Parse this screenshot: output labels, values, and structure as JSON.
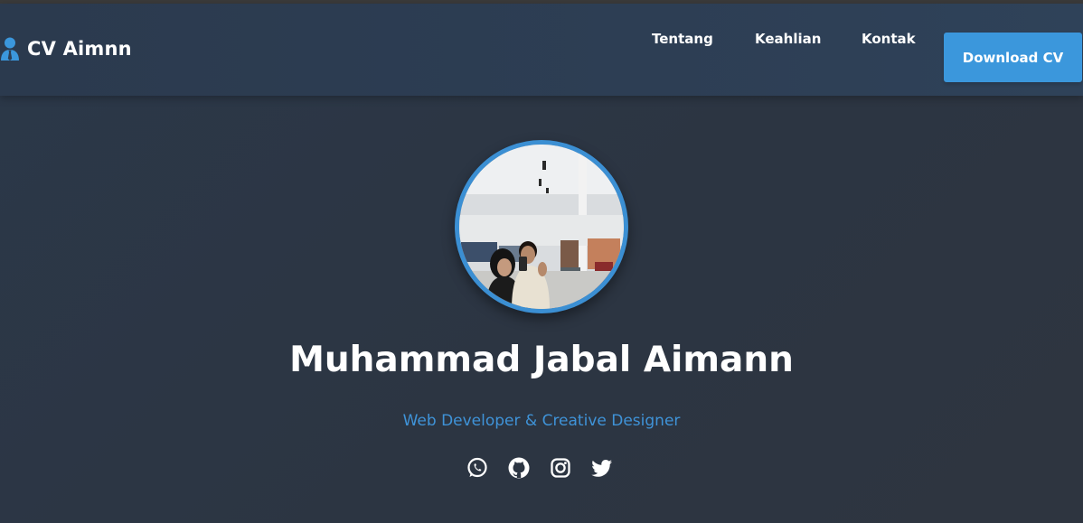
{
  "navbar": {
    "brand": "CV Aimnn",
    "brand_icon": "user-tie-icon",
    "links": [
      "Tentang",
      "Keahlian",
      "Kontak"
    ],
    "download_label": "Download CV"
  },
  "hero": {
    "name": "Muhammad Jabal Aimann",
    "subtitle": "Web Developer & Creative Designer"
  },
  "social": [
    "whatsapp-icon",
    "github-icon",
    "instagram-icon",
    "twitter-icon"
  ],
  "colors": {
    "accent": "#3b97dc",
    "navbar": "#2d3e54",
    "background": "#2c3542"
  }
}
